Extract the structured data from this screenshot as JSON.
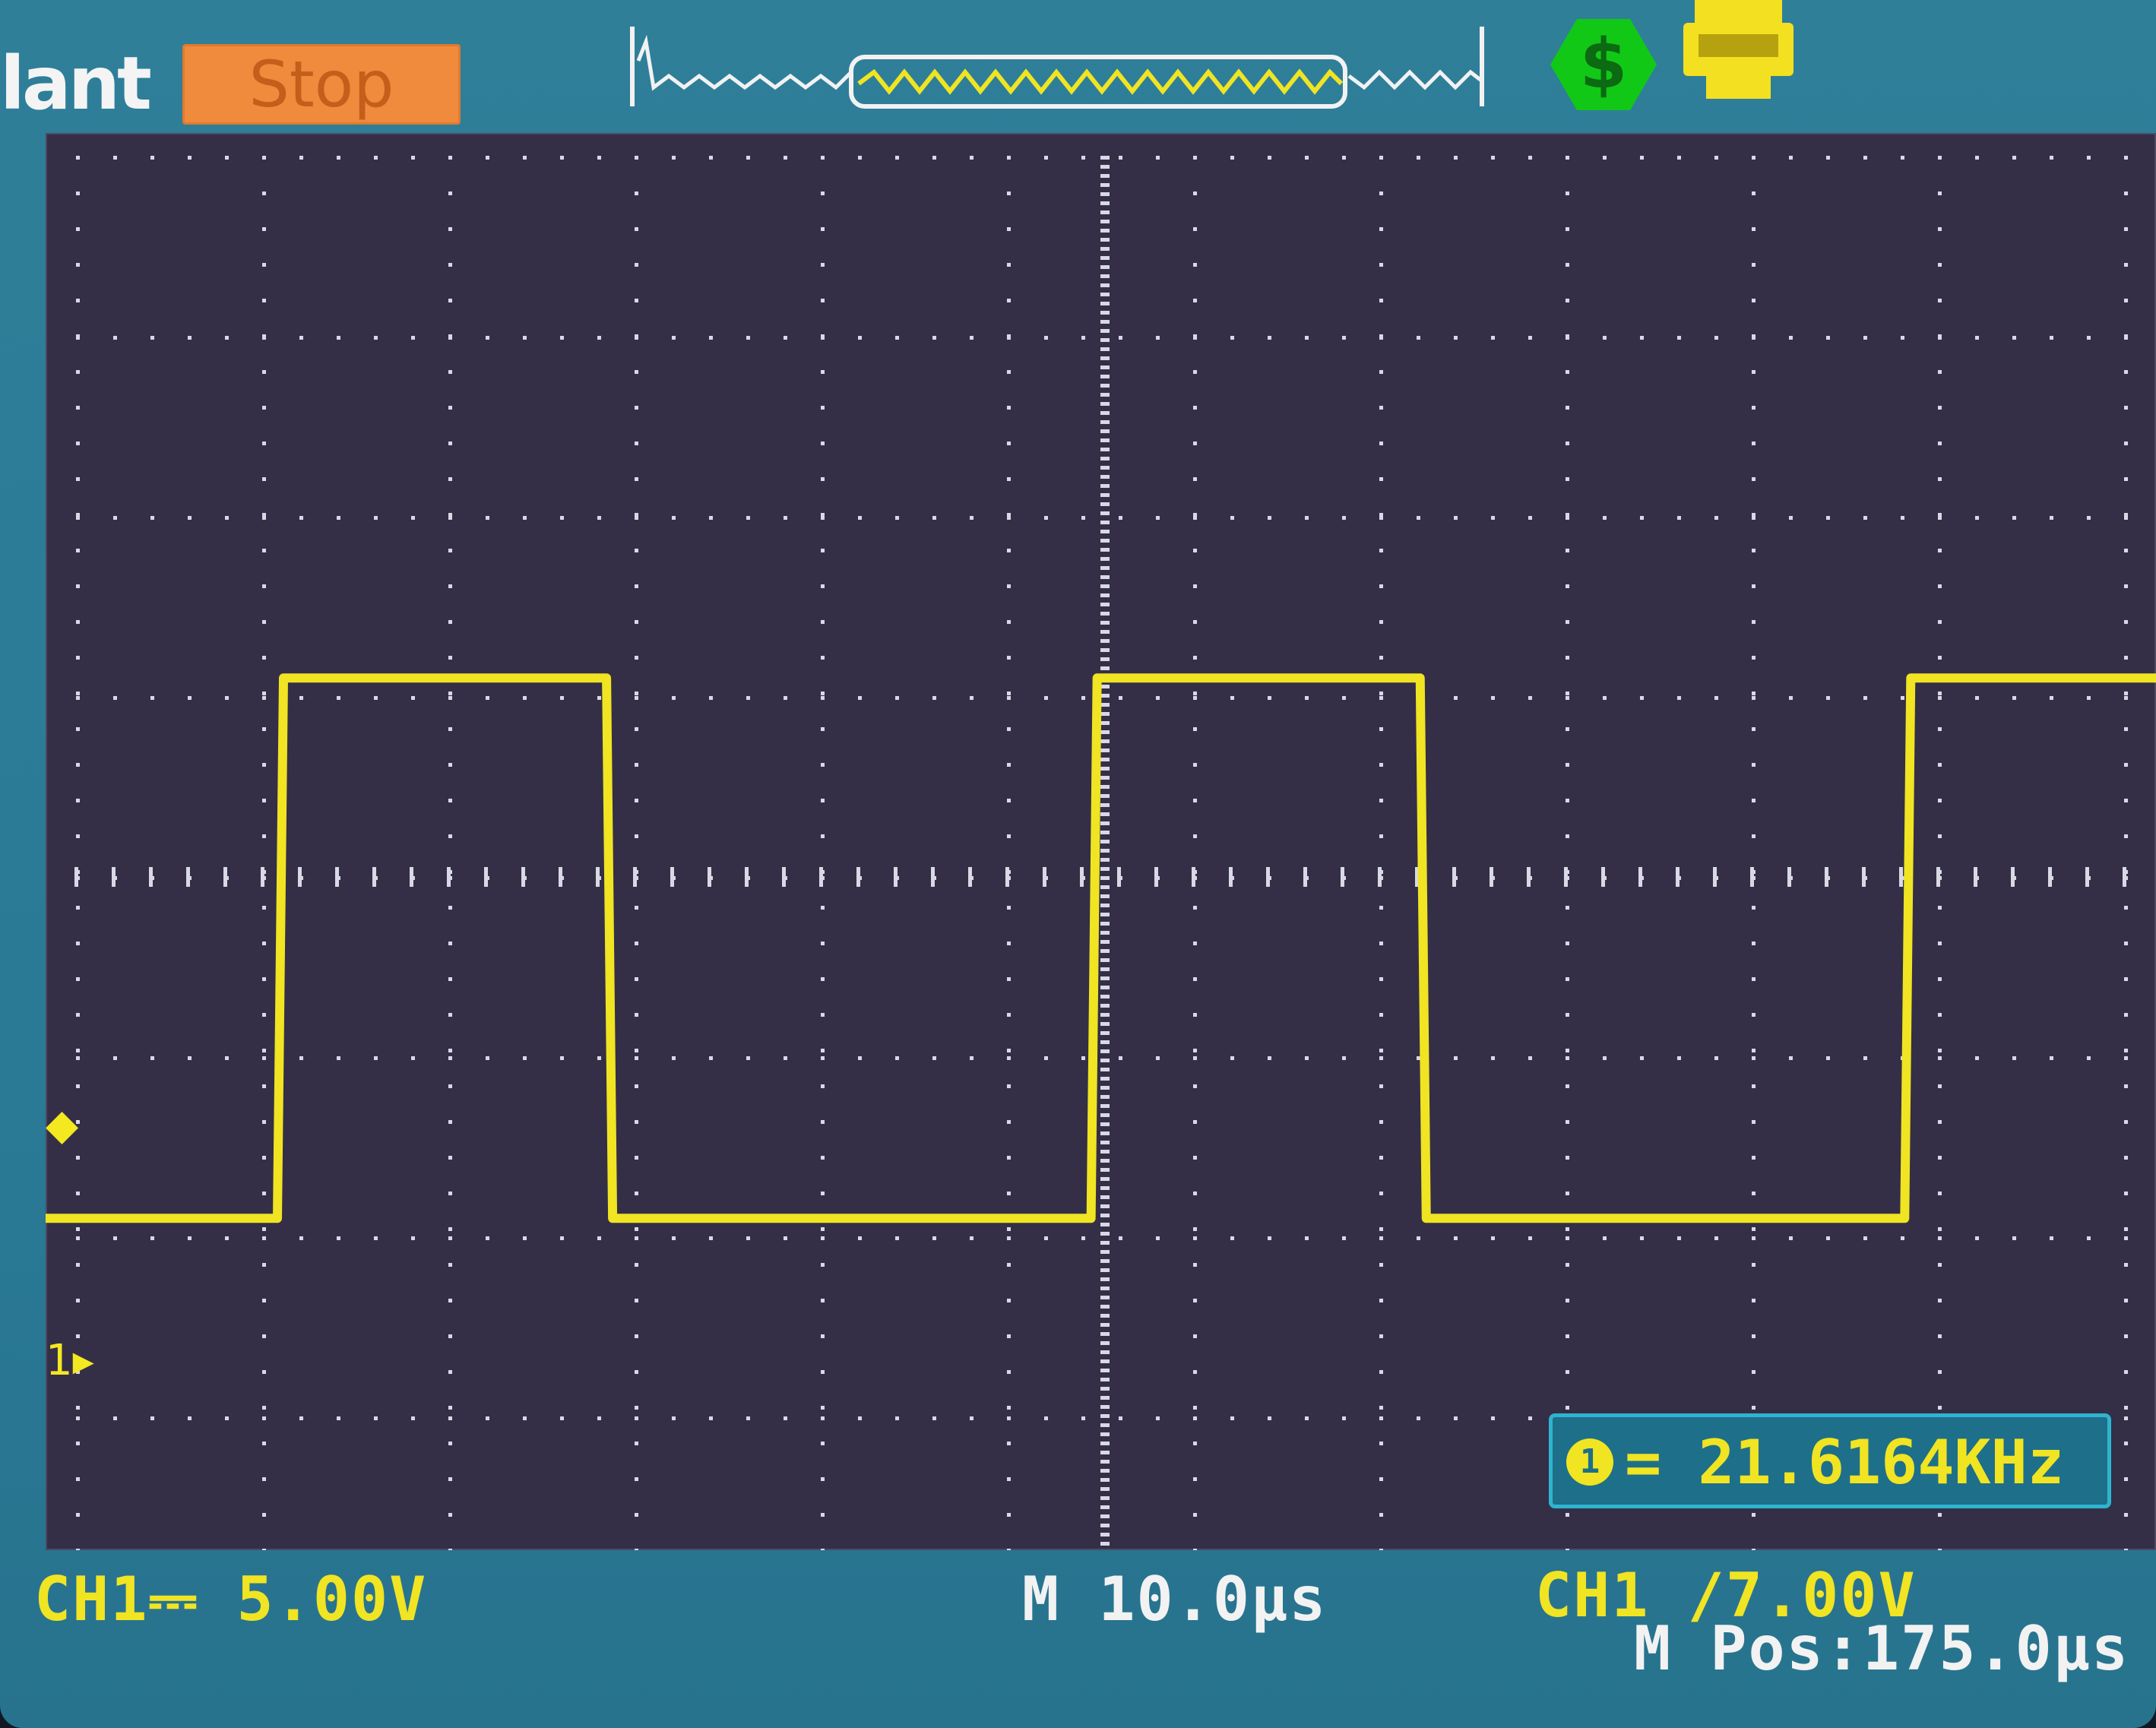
{
  "topbar": {
    "mode_label": "lant",
    "run_status": "Stop",
    "icons": {
      "memory": "waveform-memory-bar-icon",
      "status": "power-status-icon",
      "usb": "usb-storage-icon"
    }
  },
  "readouts": {
    "ch1_scale": "CH1⎓ 5.00V",
    "timebase": "M 10.0μs",
    "trigger": "CH1 ∕7.00V",
    "mpos": "M Pos:175.0μs",
    "frequency_channel": "1",
    "frequency": "= 21.6164KHz"
  },
  "colors": {
    "trace": "#f0e423",
    "screen": "#2a7a96",
    "graticule": "#342f47",
    "run_status_bg": "#f08a3c"
  },
  "waveform": {
    "type": "square",
    "high_divisions": 3.0,
    "low_divisions": 0.0,
    "period_divisions": 4.6,
    "duty_fraction": 0.36
  }
}
